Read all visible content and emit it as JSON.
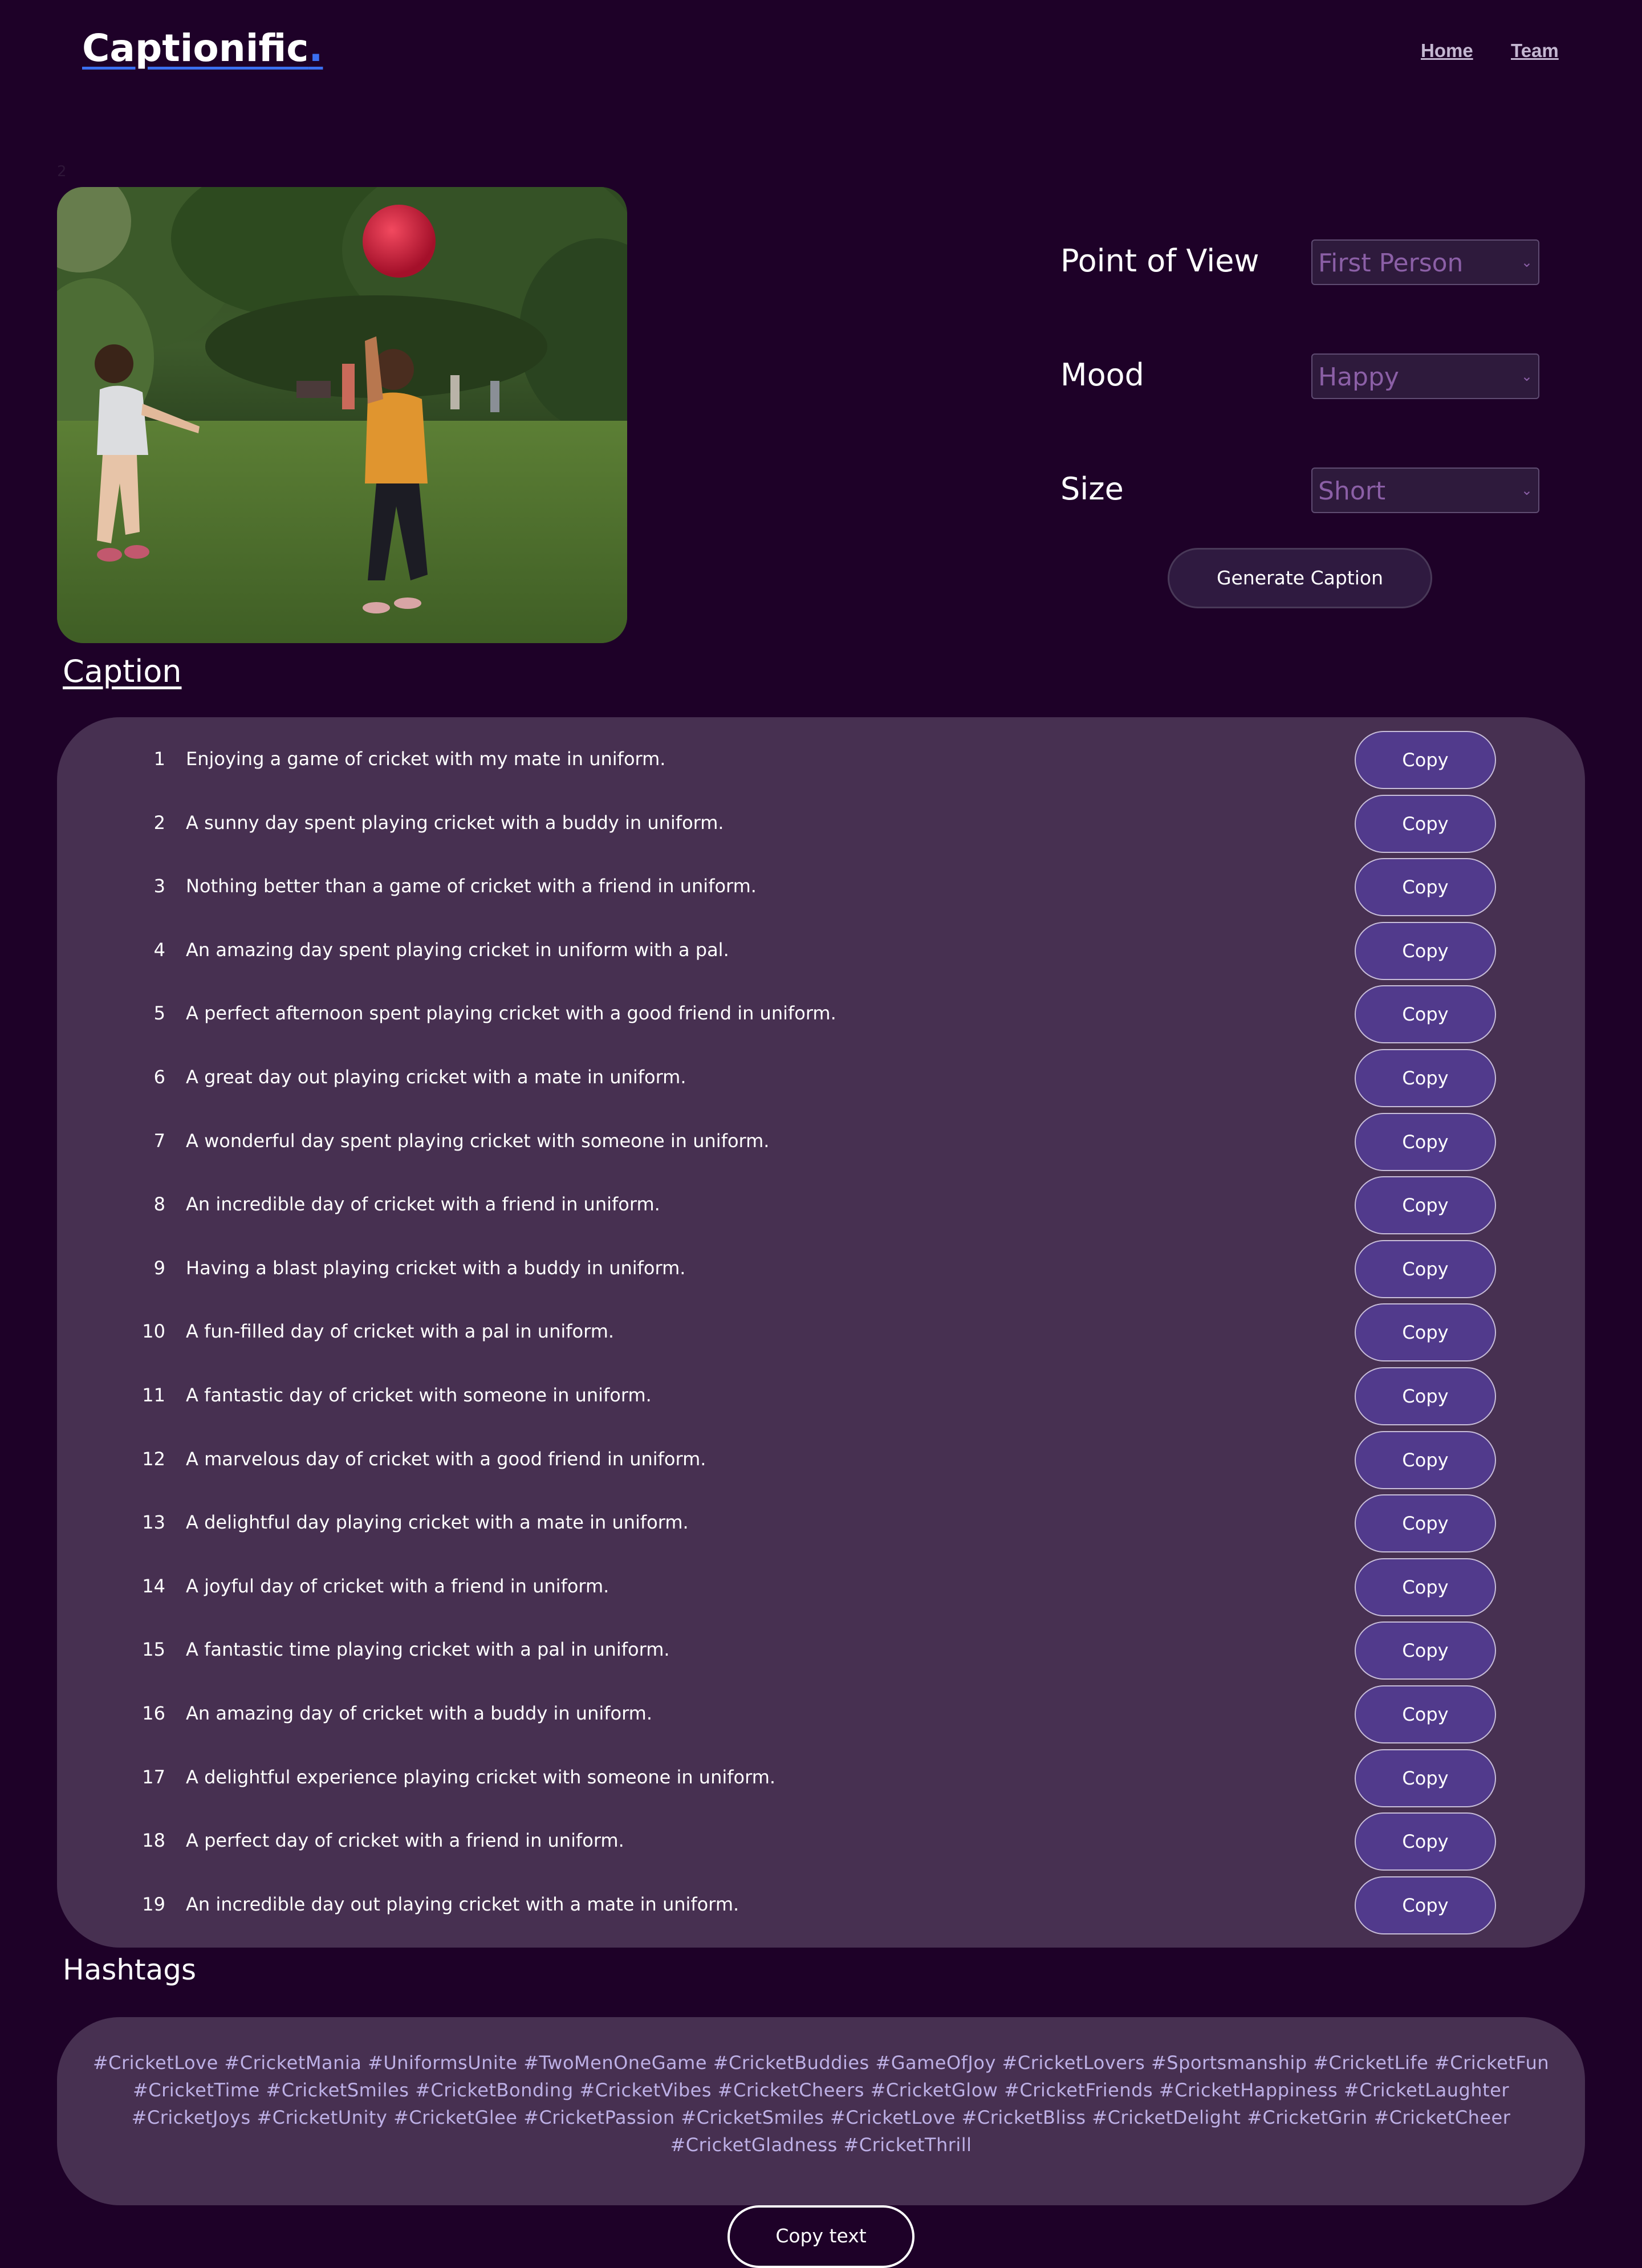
{
  "header": {
    "brand": "Captionific",
    "brand_dot": ".",
    "nav": [
      {
        "label": "Home"
      },
      {
        "label": "Team"
      }
    ],
    "stray_text": "2"
  },
  "options": {
    "pov": {
      "label": "Point of View",
      "value": "First Person"
    },
    "mood": {
      "label": "Mood",
      "value": "Happy"
    },
    "size": {
      "label": "Size",
      "value": "Short"
    },
    "generate_label": "Generate Caption"
  },
  "caption": {
    "heading": "Caption",
    "copy_label": "Copy",
    "items": [
      {
        "n": "1",
        "text": "Enjoying a game of cricket with my mate in uniform."
      },
      {
        "n": "2",
        "text": "A sunny day spent playing cricket with a buddy in uniform."
      },
      {
        "n": "3",
        "text": "Nothing better than a game of cricket with a friend in uniform."
      },
      {
        "n": "4",
        "text": "An amazing day spent playing cricket in uniform with a pal."
      },
      {
        "n": "5",
        "text": "A perfect afternoon spent playing cricket with a good friend in uniform."
      },
      {
        "n": "6",
        "text": "A great day out playing cricket with a mate in uniform."
      },
      {
        "n": "7",
        "text": "A wonderful day spent playing cricket with someone in uniform."
      },
      {
        "n": "8",
        "text": "An incredible day of cricket with a friend in uniform."
      },
      {
        "n": "9",
        "text": "Having a blast playing cricket with a buddy in uniform."
      },
      {
        "n": "10",
        "text": "A fun-filled day of cricket with a pal in uniform."
      },
      {
        "n": "11",
        "text": "A fantastic day of cricket with someone in uniform."
      },
      {
        "n": "12",
        "text": "A marvelous day of cricket with a good friend in uniform."
      },
      {
        "n": "13",
        "text": "A delightful day playing cricket with a mate in uniform."
      },
      {
        "n": "14",
        "text": "A joyful day of cricket with a friend in uniform."
      },
      {
        "n": "15",
        "text": "A fantastic time playing cricket with a pal in uniform."
      },
      {
        "n": "16",
        "text": "An amazing day of cricket with a buddy in uniform."
      },
      {
        "n": "17",
        "text": "A delightful experience playing cricket with someone in uniform."
      },
      {
        "n": "18",
        "text": "A perfect day of cricket with a friend in uniform."
      },
      {
        "n": "19",
        "text": "An incredible day out playing cricket with a mate in uniform."
      }
    ]
  },
  "hashtags": {
    "heading": "Hashtags",
    "text": "#CricketLove #CricketMania #UniformsUnite #TwoMenOneGame #CricketBuddies #GameOfJoy #CricketLovers #Sportsmanship #CricketLife #CricketFun #CricketTime #CricketSmiles #CricketBonding #CricketVibes #CricketCheers #CricketGlow #CricketFriends #CricketHappiness #CricketLaughter #CricketJoys #CricketUnity #CricketGlee #CricketPassion #CricketSmiles #CricketLove #CricketBliss #CricketDelight #CricketGrin #CricketCheer #CricketGladness #CricketThrill",
    "copy_text_label": "Copy text"
  },
  "colors": {
    "background": "#1e0128",
    "panel": "#473051",
    "copy_button": "#513a8c",
    "brand_dot": "#3b6ff0",
    "hashtag_text": "#bdb0e6"
  }
}
